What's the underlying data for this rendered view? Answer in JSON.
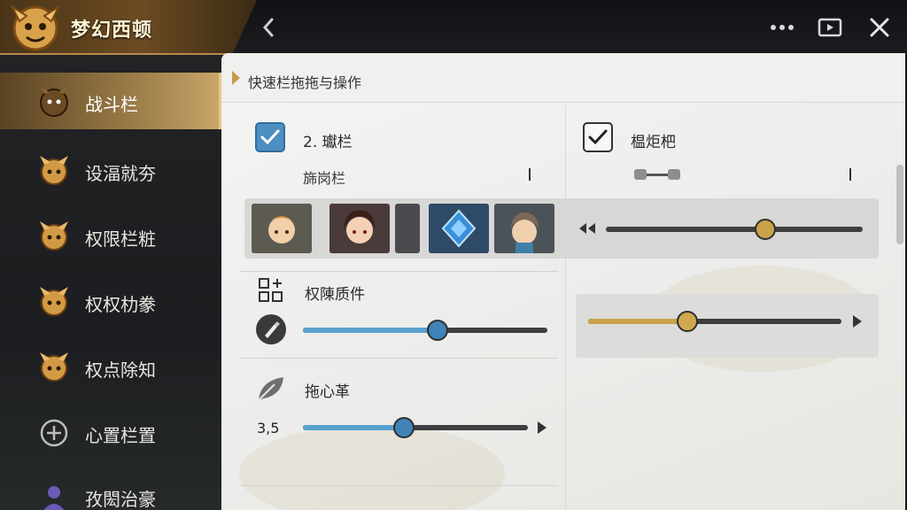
{
  "app": {
    "title": "梦幻西顿"
  },
  "topbar": {
    "back_icon": "chevron-left-icon",
    "more_icon": "ellipsis-icon",
    "screen_icon": "play-screen-icon",
    "close_icon": "close-icon"
  },
  "sidebar": {
    "items": [
      {
        "label": "战斗栏",
        "icon": "hero-avatar-icon",
        "active": true
      },
      {
        "label": "设湢就夯",
        "icon": "hero-avatar-icon",
        "active": false
      },
      {
        "label": "权限栏粧",
        "icon": "hero-avatar-icon",
        "active": false
      },
      {
        "label": "权权朸豢",
        "icon": "hero-avatar-icon",
        "active": false
      },
      {
        "label": "权点除知",
        "icon": "hero-avatar-icon",
        "active": false
      },
      {
        "label": "心置栏置",
        "icon": "plus-circle-icon",
        "active": false
      },
      {
        "label": "孜閎治豪",
        "icon": "user-icon",
        "active": false
      }
    ]
  },
  "panel": {
    "title": "快速栏拖拖与操作",
    "left_check": {
      "label": "2. 瓛栏",
      "checked": true
    },
    "left_sub": "旆岗栏",
    "right_check": {
      "label": "榅炬杷",
      "checked": true
    },
    "volume_level": 0.62,
    "section1": {
      "label": "权陳质件",
      "icon": "grid-plus-icon",
      "tool_icon": "pen-tool-icon",
      "value": 0.55
    },
    "right_slider": {
      "value": 0.39,
      "accent": "#c9a24a"
    },
    "section2": {
      "label": "拖心革",
      "icon": "leaf-icon",
      "value_text": "3,5",
      "value": 0.45
    }
  },
  "colors": {
    "accent_gold": "#c89b4f",
    "accent_blue": "#4d8fc0",
    "sidebar_active": "#a4854e"
  }
}
